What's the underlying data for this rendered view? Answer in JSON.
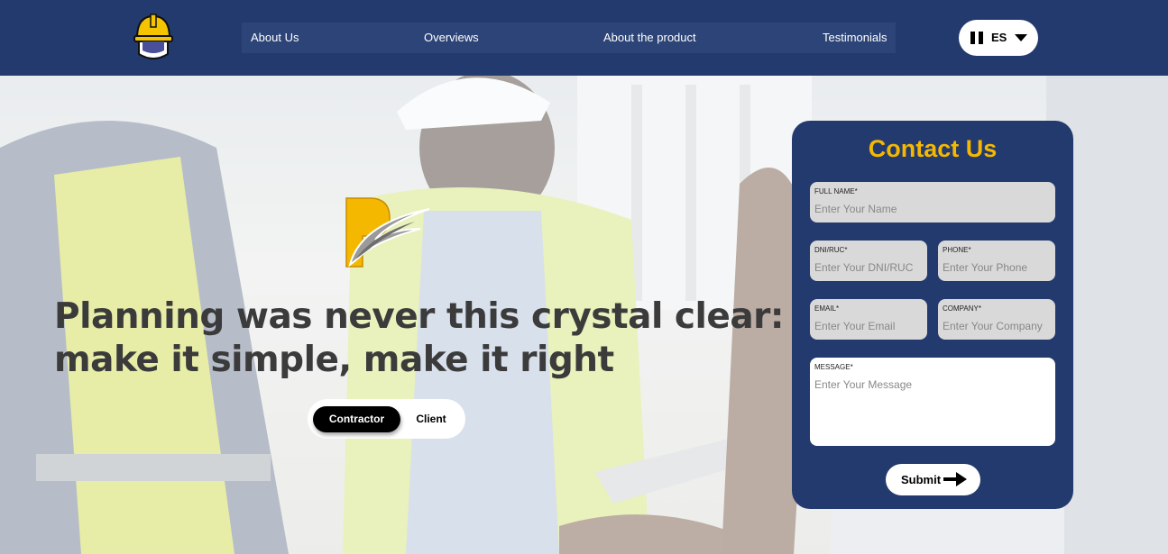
{
  "header": {
    "logo_icon": "hard-hat-helmet-logo",
    "nav": [
      {
        "label": "About Us"
      },
      {
        "label": "Overviews"
      },
      {
        "label": "About the product"
      },
      {
        "label": "Testimonials"
      }
    ],
    "language": {
      "icon": "flag-icon",
      "code": "ES"
    }
  },
  "hero": {
    "brand_icon": "p-brand-mark",
    "headline_line1": "Planning was never this crystal clear:",
    "headline_line2": "make it simple, make it right",
    "toggle": {
      "active": "Contractor",
      "inactive": "Client"
    }
  },
  "contact": {
    "title": "Contact Us",
    "full_name": {
      "label": "FULL NAME*",
      "placeholder": "Enter Your Name"
    },
    "dni": {
      "label": "DNI/RUC*",
      "placeholder": "Enter Your DNI/RUC"
    },
    "phone": {
      "label": "PHONE*",
      "placeholder": "Enter Your Phone"
    },
    "email": {
      "label": "EMAIL*",
      "placeholder": "Enter Your Email"
    },
    "company": {
      "label": "COMPANY*",
      "placeholder": "Enter Your Company"
    },
    "message": {
      "label": "MESSAGE*",
      "placeholder": "Enter Your Message"
    },
    "submit": {
      "label": "Submit",
      "icon": "arrow-right-icon"
    }
  },
  "colors": {
    "navy": "#233a6e",
    "accent_yellow": "#f5b800",
    "headline": "#3b3b3b"
  }
}
